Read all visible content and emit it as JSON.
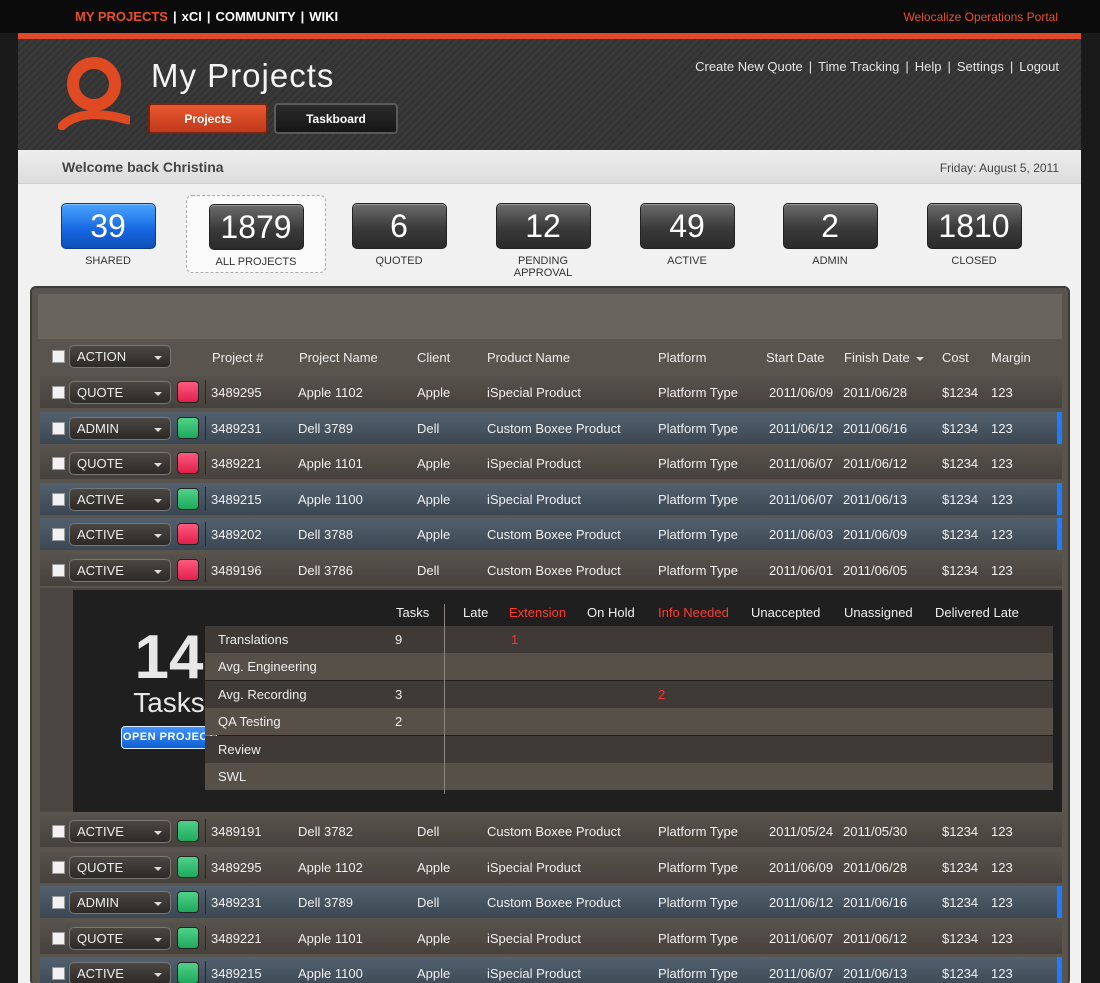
{
  "topnav": {
    "items": [
      "MY PROJECTS",
      "xCI",
      "COMMUNITY",
      "WIKI"
    ],
    "portal": "Welocalize Operations Portal"
  },
  "header": {
    "title": "My Projects",
    "tabs": [
      "Projects",
      "Taskboard"
    ],
    "links": [
      "Create New Quote",
      "Time Tracking",
      "Help",
      "Settings",
      "Logout"
    ]
  },
  "welcome": {
    "text": "Welcome back Christina",
    "date": "Friday: August 5, 2011"
  },
  "stats": [
    {
      "value": "39",
      "label": "SHARED"
    },
    {
      "value": "1879",
      "label": "ALL PROJECTS"
    },
    {
      "value": "6",
      "label": "QUOTED"
    },
    {
      "value": "12",
      "label": "PENDING APPROVAL"
    },
    {
      "value": "49",
      "label": "ACTIVE"
    },
    {
      "value": "2",
      "label": "ADMIN"
    },
    {
      "value": "1810",
      "label": "CLOSED"
    }
  ],
  "table": {
    "action_label": "ACTION",
    "columns": [
      "Project #",
      "Project Name",
      "Client",
      "Product Name",
      "Platform",
      "Start Date",
      "Finish Date",
      "Cost",
      "Margin"
    ],
    "rows_top": [
      {
        "status": "QUOTE",
        "chip": "red",
        "num": "3489295",
        "name": "Apple 1102",
        "client": "Apple",
        "product": "iSpecial Product",
        "platform": "Platform Type",
        "start": "2011/06/09",
        "finish": "2011/06/28",
        "cost": "$1234",
        "margin": "123",
        "style": "dark"
      },
      {
        "status": "ADMIN",
        "chip": "green",
        "num": "3489231",
        "name": "Dell 3789",
        "client": "Dell",
        "product": "Custom Boxee Product",
        "platform": "Platform Type",
        "start": "2011/06/12",
        "finish": "2011/06/16",
        "cost": "$1234",
        "margin": "123",
        "style": "blue"
      },
      {
        "status": "QUOTE",
        "chip": "red",
        "num": "3489221",
        "name": "Apple 1101",
        "client": "Apple",
        "product": "iSpecial Product",
        "platform": "Platform Type",
        "start": "2011/06/07",
        "finish": "2011/06/12",
        "cost": "$1234",
        "margin": "123",
        "style": "dark"
      },
      {
        "status": "ACTIVE",
        "chip": "green",
        "num": "3489215",
        "name": "Apple 1100",
        "client": "Apple",
        "product": "iSpecial Product",
        "platform": "Platform Type",
        "start": "2011/06/07",
        "finish": "2011/06/13",
        "cost": "$1234",
        "margin": "123",
        "style": "blue"
      },
      {
        "status": "ACTIVE",
        "chip": "red",
        "num": "3489202",
        "name": "Dell 3788",
        "client": "Apple",
        "product": "Custom Boxee Product",
        "platform": "Platform Type",
        "start": "2011/06/03",
        "finish": "2011/06/09",
        "cost": "$1234",
        "margin": "123",
        "style": "blue"
      },
      {
        "status": "ACTIVE",
        "chip": "red",
        "num": "3489196",
        "name": "Dell 3786",
        "client": "Dell",
        "product": "Custom Boxee Product",
        "platform": "Platform Type",
        "start": "2011/06/01",
        "finish": "2011/06/05",
        "cost": "$1234",
        "margin": "123",
        "style": "dark"
      }
    ],
    "rows_bottom": [
      {
        "status": "ACTIVE",
        "chip": "green",
        "num": "3489191",
        "name": "Dell 3782",
        "client": "Dell",
        "product": "Custom Boxee Product",
        "platform": "Platform Type",
        "start": "2011/05/24",
        "finish": "2011/05/30",
        "cost": "$1234",
        "margin": "123",
        "style": "dark"
      },
      {
        "status": "QUOTE",
        "chip": "green",
        "num": "3489295",
        "name": "Apple 1102",
        "client": "Apple",
        "product": "iSpecial Product",
        "platform": "Platform Type",
        "start": "2011/06/09",
        "finish": "2011/06/28",
        "cost": "$1234",
        "margin": "123",
        "style": "dark"
      },
      {
        "status": "ADMIN",
        "chip": "green",
        "num": "3489231",
        "name": "Dell 3789",
        "client": "Dell",
        "product": "Custom Boxee Product",
        "platform": "Platform Type",
        "start": "2011/06/12",
        "finish": "2011/06/16",
        "cost": "$1234",
        "margin": "123",
        "style": "blue"
      },
      {
        "status": "QUOTE",
        "chip": "green",
        "num": "3489221",
        "name": "Apple 1101",
        "client": "Apple",
        "product": "iSpecial Product",
        "platform": "Platform Type",
        "start": "2011/06/07",
        "finish": "2011/06/12",
        "cost": "$1234",
        "margin": "123",
        "style": "dark"
      },
      {
        "status": "ACTIVE",
        "chip": "green",
        "num": "3489215",
        "name": "Apple 1100",
        "client": "Apple",
        "product": "iSpecial Product",
        "platform": "Platform Type",
        "start": "2011/06/07",
        "finish": "2011/06/13",
        "cost": "$1234",
        "margin": "123",
        "style": "blue"
      }
    ]
  },
  "detail": {
    "count": "14",
    "count_label": "Tasks",
    "open_button": "OPEN PROJECT",
    "headers": [
      "Tasks",
      "Late",
      "Extension",
      "On Hold",
      "Info Needed",
      "Unaccepted",
      "Unassigned",
      "Delivered Late"
    ],
    "red_headers": [
      "Extension",
      "Info Needed"
    ],
    "tasks": [
      {
        "name": "Translations",
        "count": "9",
        "flag": "1",
        "flag_col": "Extension"
      },
      {
        "name": "Avg. Engineering",
        "count": "",
        "flag": "",
        "flag_col": ""
      },
      {
        "name": "Avg. Recording",
        "count": "3",
        "flag": "2",
        "flag_col": "Info Needed"
      },
      {
        "name": "QA Testing",
        "count": "2",
        "flag": "",
        "flag_col": ""
      },
      {
        "name": "Review",
        "count": "",
        "flag": "",
        "flag_col": ""
      },
      {
        "name": "SWL",
        "count": "",
        "flag": "",
        "flag_col": ""
      }
    ]
  },
  "colors": {
    "accent": "#e8502b",
    "blue_stat": "#1566e0",
    "row_blue_marker": "#1e7cff",
    "chip_red": "#e01f4b",
    "chip_green": "#1ea95d"
  }
}
